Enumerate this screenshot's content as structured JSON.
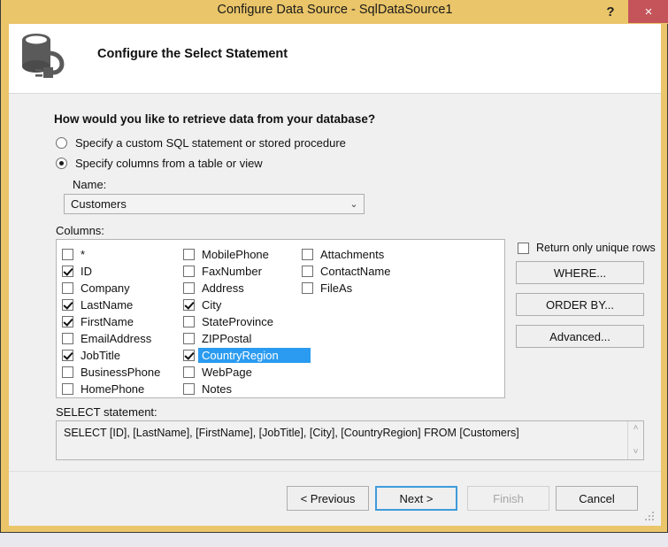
{
  "window": {
    "title": "Configure Data Source - SqlDataSource1",
    "help_label": "?",
    "close_label": "×",
    "icon": "database-plug-icon"
  },
  "header": {
    "title": "Configure the Select Statement"
  },
  "body": {
    "question": "How would you like to retrieve data from your database?",
    "radio_options": [
      {
        "label": "Specify a custom SQL statement or stored procedure",
        "checked": false
      },
      {
        "label": "Specify columns from a table or view",
        "checked": true
      }
    ],
    "name_label": "Name:",
    "table_select": {
      "value": "Customers",
      "arrow": "⌄"
    },
    "columns_label": "Columns:",
    "columns": {
      "col1": [
        {
          "label": "*",
          "checked": false,
          "selected": false
        },
        {
          "label": "ID",
          "checked": true,
          "selected": false
        },
        {
          "label": "Company",
          "checked": false,
          "selected": false
        },
        {
          "label": "LastName",
          "checked": true,
          "selected": false
        },
        {
          "label": "FirstName",
          "checked": true,
          "selected": false
        },
        {
          "label": "EmailAddress",
          "checked": false,
          "selected": false
        },
        {
          "label": "JobTitle",
          "checked": true,
          "selected": false
        },
        {
          "label": "BusinessPhone",
          "checked": false,
          "selected": false
        },
        {
          "label": "HomePhone",
          "checked": false,
          "selected": false
        }
      ],
      "col2": [
        {
          "label": "MobilePhone",
          "checked": false,
          "selected": false
        },
        {
          "label": "FaxNumber",
          "checked": false,
          "selected": false
        },
        {
          "label": "Address",
          "checked": false,
          "selected": false
        },
        {
          "label": "City",
          "checked": true,
          "selected": false
        },
        {
          "label": "StateProvince",
          "checked": false,
          "selected": false
        },
        {
          "label": "ZIPPostal",
          "checked": false,
          "selected": false
        },
        {
          "label": "CountryRegion",
          "checked": true,
          "selected": true
        },
        {
          "label": "WebPage",
          "checked": false,
          "selected": false
        },
        {
          "label": "Notes",
          "checked": false,
          "selected": false
        }
      ],
      "col3": [
        {
          "label": "Attachments",
          "checked": false,
          "selected": false
        },
        {
          "label": "ContactName",
          "checked": false,
          "selected": false
        },
        {
          "label": "FileAs",
          "checked": false,
          "selected": false
        }
      ]
    },
    "unique_rows": {
      "label": "Return only unique rows",
      "checked": false
    },
    "side_buttons": [
      {
        "label": "WHERE..."
      },
      {
        "label": "ORDER BY..."
      },
      {
        "label": "Advanced..."
      }
    ],
    "select_statement_label": "SELECT statement:",
    "select_statement": "SELECT [ID], [LastName], [FirstName], [JobTitle], [City], [CountryRegion] FROM [Customers]",
    "scroll_up": "˄",
    "scroll_down": "˅"
  },
  "footer": {
    "buttons": [
      {
        "label": "< Previous",
        "state": "normal"
      },
      {
        "label": "Next >",
        "state": "focused"
      },
      {
        "label": "Finish",
        "state": "disabled"
      },
      {
        "label": "Cancel",
        "state": "normal"
      }
    ]
  },
  "colors": {
    "frame": "#eac569",
    "close": "#c4545a",
    "selection": "#2a9bf0",
    "focus": "#3f9bdc",
    "body": "#f0f0f0"
  }
}
